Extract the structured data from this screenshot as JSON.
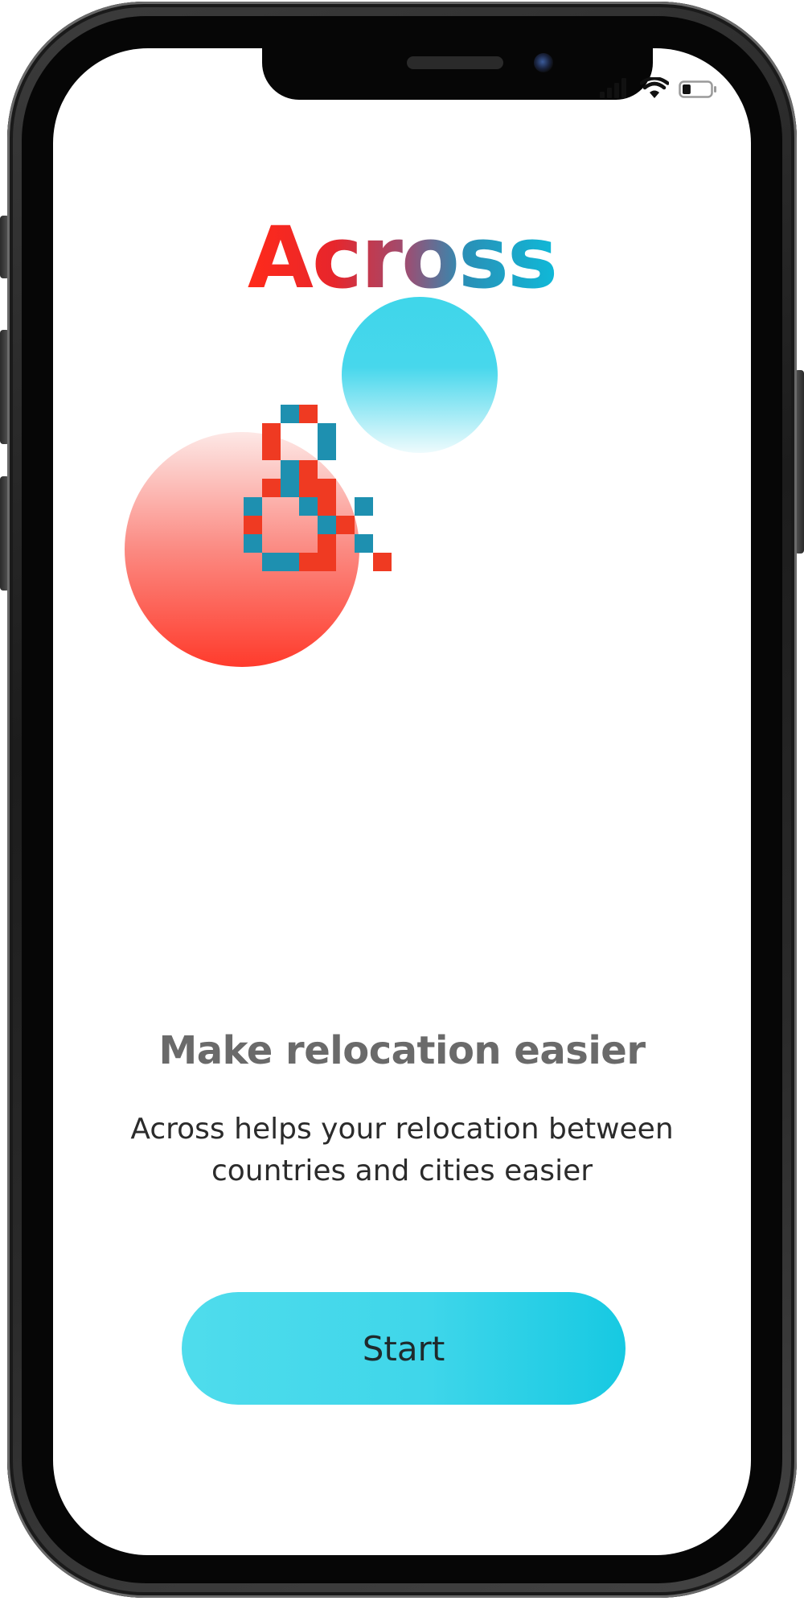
{
  "app": {
    "logo_text": "Across"
  },
  "onboarding": {
    "headline": "Make relocation easier",
    "description": "Across helps your relocation between countries and cities easier",
    "start_label": "Start"
  },
  "status_bar": {
    "icons": [
      "signal-icon",
      "wifi-icon",
      "battery-icon"
    ],
    "battery_level": 0.3
  },
  "colors": {
    "accent_cyan": "#1ccbe4",
    "accent_red": "#ef3a22",
    "pixel_blue": "#1e90b0"
  }
}
